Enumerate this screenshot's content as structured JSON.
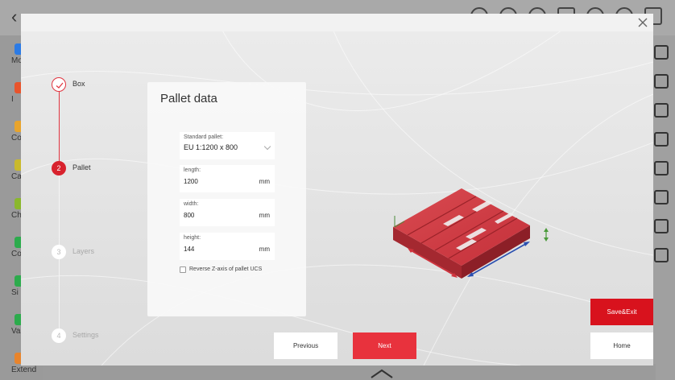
{
  "background": {
    "left_items": [
      {
        "label": "Mo",
        "color": "#2c7be5"
      },
      {
        "label": "I",
        "color": "#e8542c"
      },
      {
        "label": "Co",
        "color": "#e8a42c"
      },
      {
        "label": "Calc",
        "color": "#c9b92c"
      },
      {
        "label": "Char",
        "color": "#8ab72c"
      },
      {
        "label": "Co",
        "color": "#2cab4c"
      },
      {
        "label": "Si",
        "color": "#2cab4c"
      },
      {
        "label": "Vari",
        "color": "#2cab4c"
      },
      {
        "label": "Extend",
        "color": "#e8842c"
      }
    ]
  },
  "stepper": {
    "steps": [
      {
        "number": "✓",
        "label": "Box",
        "state": "done"
      },
      {
        "number": "2",
        "label": "Pallet",
        "state": "active"
      },
      {
        "number": "3",
        "label": "Layers",
        "state": "todo"
      },
      {
        "number": "4",
        "label": "Settings",
        "state": "todo"
      }
    ]
  },
  "card": {
    "title": "Pallet data",
    "standard_pallet": {
      "label": "Standard pallet:",
      "value": "EU 1:1200 x 800"
    },
    "length": {
      "label": "length:",
      "value": "1200",
      "unit": "mm"
    },
    "width": {
      "label": "width:",
      "value": "800",
      "unit": "mm"
    },
    "height": {
      "label": "height:",
      "value": "144",
      "unit": "mm"
    },
    "reverse_z": {
      "label": "Reverse Z-axis of pallet UCS",
      "checked": false
    }
  },
  "buttons": {
    "previous": "Previous",
    "next": "Next",
    "save_exit": "Save&Exit",
    "home": "Home"
  },
  "colors": {
    "accent": "#e8323d",
    "pallet": "#d33a41"
  }
}
